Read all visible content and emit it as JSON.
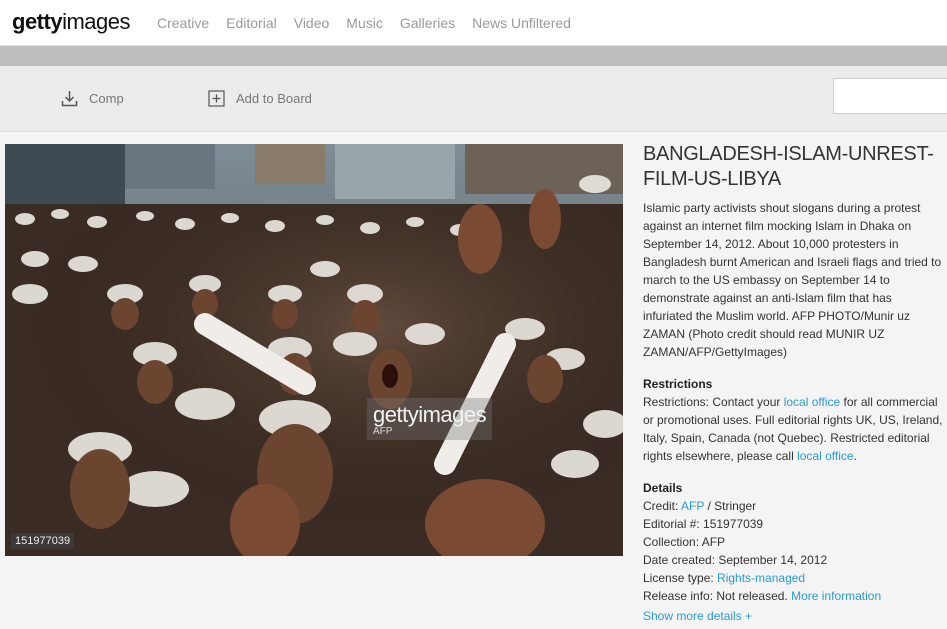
{
  "logo": {
    "bold": "getty",
    "rest": "images"
  },
  "nav": [
    "Creative",
    "Editorial",
    "Video",
    "Music",
    "Galleries",
    "News Unfiltered"
  ],
  "toolbar": {
    "comp_label": "Comp",
    "board_label": "Add to Board",
    "search_placeholder": ""
  },
  "photo": {
    "watermark_brand": "getty",
    "watermark_rest": "images",
    "watermark_agency": "AFP",
    "id": "151977039"
  },
  "asset": {
    "title": "BANGLADESH-ISLAM-UNREST-FILM-US-LIBYA",
    "caption": "Islamic party activists shout slogans during a protest against an internet film mocking Islam in Dhaka on September 14, 2012. About 10,000 protesters in Bangladesh burnt American and Israeli flags and tried to march to the US embassy on September 14 to demonstrate against an anti-Islam film that has infuriated the Muslim world. AFP PHOTO/Munir uz ZAMAN (Photo credit should read MUNIR UZ ZAMAN/AFP/GettyImages)"
  },
  "restrictions": {
    "heading": "Restrictions",
    "text_a": "Restrictions: Contact your ",
    "link_a": "local office",
    "text_b": " for all commercial or promotional uses. Full editorial rights UK, US, Ireland, Italy, Spain, Canada (not Quebec). Restricted editorial rights elsewhere, please call ",
    "link_b": "local office",
    "text_c": "."
  },
  "details": {
    "heading": "Details",
    "credit_label": "Credit: ",
    "credit_link": "AFP",
    "credit_rest": " / Stringer",
    "editorial": "Editorial #: 151977039",
    "collection": "Collection: AFP",
    "date_created": "Date created: September 14, 2012",
    "license_label": "License type: ",
    "license_link": "Rights-managed",
    "release_label": "Release info: Not released. ",
    "release_link": "More information",
    "show_more": "Show more details  +"
  },
  "colors": {
    "link": "#2b9bd3",
    "nav": "#9a9a9a"
  }
}
